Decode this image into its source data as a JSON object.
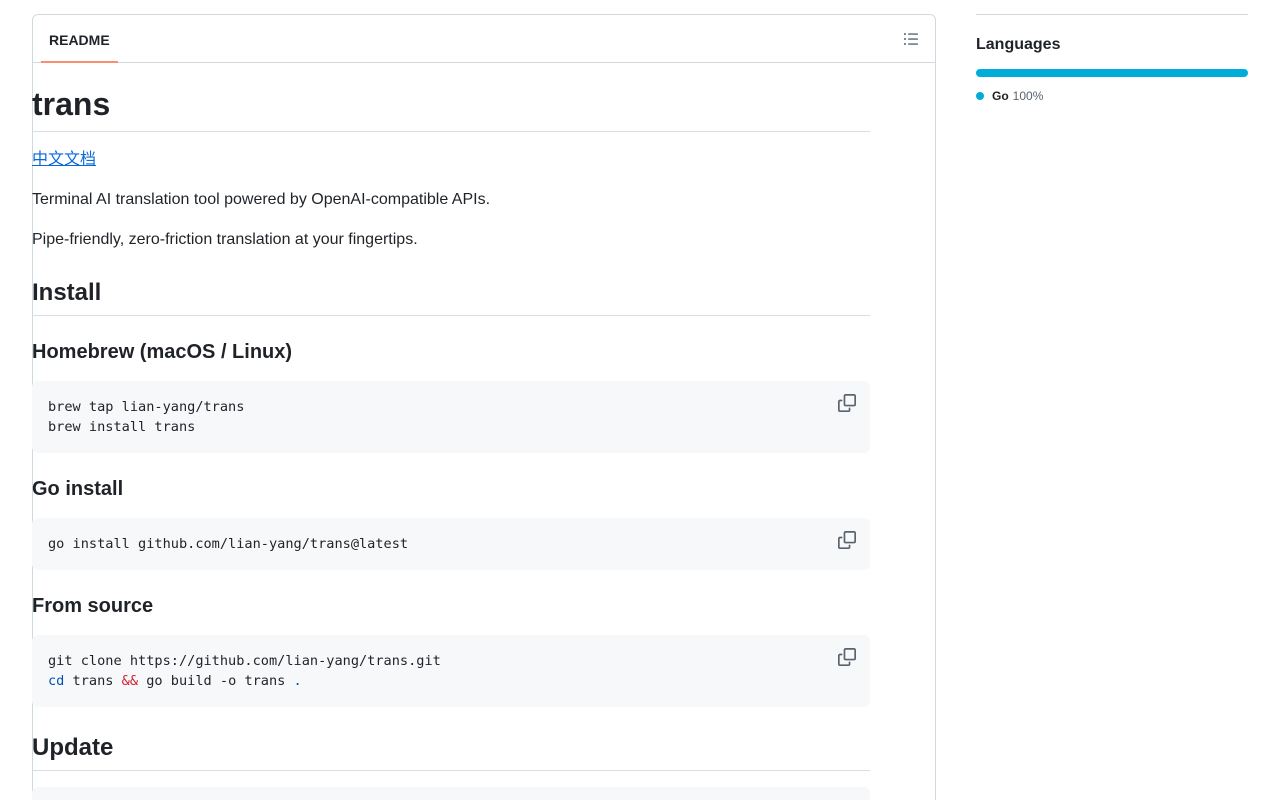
{
  "readme": {
    "tab_label": "README",
    "title": "trans",
    "lang_link": "中文文档",
    "desc1": "Terminal AI translation tool powered by OpenAI-compatible APIs.",
    "desc2": "Pipe-friendly, zero-friction translation at your fingertips.",
    "install_heading": "Install",
    "homebrew_heading": "Homebrew (macOS / Linux)",
    "homebrew_code_line1": "brew tap lian-yang/trans",
    "homebrew_code_line2": "brew install trans",
    "goinstall_heading": "Go install",
    "goinstall_code": "go install github.com/lian-yang/trans@latest",
    "source_heading": "From source",
    "source_code_line1": "git clone https://github.com/lian-yang/trans.git",
    "source_code_line2_kw": "cd",
    "source_code_line2_a": " trans ",
    "source_code_line2_op": "&&",
    "source_code_line2_b": " go build -o trans ",
    "source_code_line2_dot": ".",
    "update_heading": "Update"
  },
  "sidebar": {
    "languages_title": "Languages",
    "languages": [
      {
        "name": "Go",
        "percent": "100%",
        "color": "#00ADD8"
      }
    ]
  },
  "colors": {
    "accent_tab": "#fd8c73",
    "link": "#0969da",
    "go": "#00ADD8"
  },
  "icons": {
    "toc": "list-unordered-icon",
    "copy": "copy-icon"
  }
}
